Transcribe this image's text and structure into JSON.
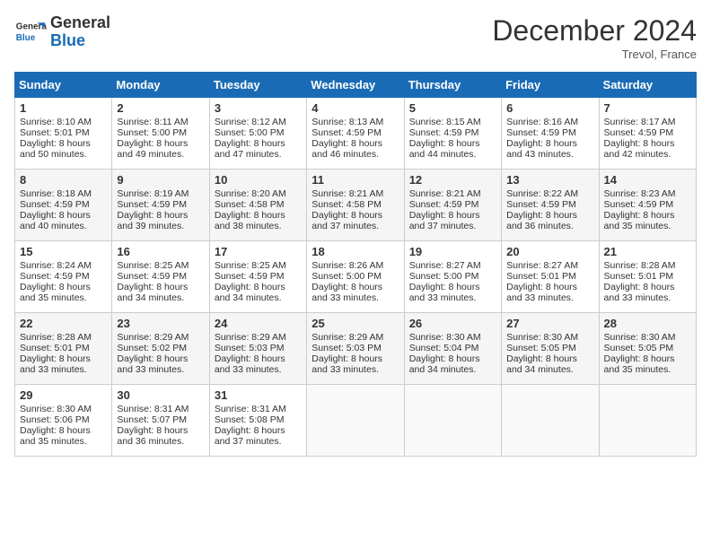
{
  "header": {
    "logo_line1": "General",
    "logo_line2": "Blue",
    "month": "December 2024",
    "location": "Trevol, France"
  },
  "days_of_week": [
    "Sunday",
    "Monday",
    "Tuesday",
    "Wednesday",
    "Thursday",
    "Friday",
    "Saturday"
  ],
  "weeks": [
    [
      {
        "day": "1",
        "sunrise": "8:10 AM",
        "sunset": "5:01 PM",
        "daylight": "8 hours and 50 minutes."
      },
      {
        "day": "2",
        "sunrise": "8:11 AM",
        "sunset": "5:00 PM",
        "daylight": "8 hours and 49 minutes."
      },
      {
        "day": "3",
        "sunrise": "8:12 AM",
        "sunset": "5:00 PM",
        "daylight": "8 hours and 47 minutes."
      },
      {
        "day": "4",
        "sunrise": "8:13 AM",
        "sunset": "4:59 PM",
        "daylight": "8 hours and 46 minutes."
      },
      {
        "day": "5",
        "sunrise": "8:15 AM",
        "sunset": "4:59 PM",
        "daylight": "8 hours and 44 minutes."
      },
      {
        "day": "6",
        "sunrise": "8:16 AM",
        "sunset": "4:59 PM",
        "daylight": "8 hours and 43 minutes."
      },
      {
        "day": "7",
        "sunrise": "8:17 AM",
        "sunset": "4:59 PM",
        "daylight": "8 hours and 42 minutes."
      }
    ],
    [
      {
        "day": "8",
        "sunrise": "8:18 AM",
        "sunset": "4:59 PM",
        "daylight": "8 hours and 40 minutes."
      },
      {
        "day": "9",
        "sunrise": "8:19 AM",
        "sunset": "4:59 PM",
        "daylight": "8 hours and 39 minutes."
      },
      {
        "day": "10",
        "sunrise": "8:20 AM",
        "sunset": "4:58 PM",
        "daylight": "8 hours and 38 minutes."
      },
      {
        "day": "11",
        "sunrise": "8:21 AM",
        "sunset": "4:58 PM",
        "daylight": "8 hours and 37 minutes."
      },
      {
        "day": "12",
        "sunrise": "8:21 AM",
        "sunset": "4:59 PM",
        "daylight": "8 hours and 37 minutes."
      },
      {
        "day": "13",
        "sunrise": "8:22 AM",
        "sunset": "4:59 PM",
        "daylight": "8 hours and 36 minutes."
      },
      {
        "day": "14",
        "sunrise": "8:23 AM",
        "sunset": "4:59 PM",
        "daylight": "8 hours and 35 minutes."
      }
    ],
    [
      {
        "day": "15",
        "sunrise": "8:24 AM",
        "sunset": "4:59 PM",
        "daylight": "8 hours and 35 minutes."
      },
      {
        "day": "16",
        "sunrise": "8:25 AM",
        "sunset": "4:59 PM",
        "daylight": "8 hours and 34 minutes."
      },
      {
        "day": "17",
        "sunrise": "8:25 AM",
        "sunset": "4:59 PM",
        "daylight": "8 hours and 34 minutes."
      },
      {
        "day": "18",
        "sunrise": "8:26 AM",
        "sunset": "5:00 PM",
        "daylight": "8 hours and 33 minutes."
      },
      {
        "day": "19",
        "sunrise": "8:27 AM",
        "sunset": "5:00 PM",
        "daylight": "8 hours and 33 minutes."
      },
      {
        "day": "20",
        "sunrise": "8:27 AM",
        "sunset": "5:01 PM",
        "daylight": "8 hours and 33 minutes."
      },
      {
        "day": "21",
        "sunrise": "8:28 AM",
        "sunset": "5:01 PM",
        "daylight": "8 hours and 33 minutes."
      }
    ],
    [
      {
        "day": "22",
        "sunrise": "8:28 AM",
        "sunset": "5:01 PM",
        "daylight": "8 hours and 33 minutes."
      },
      {
        "day": "23",
        "sunrise": "8:29 AM",
        "sunset": "5:02 PM",
        "daylight": "8 hours and 33 minutes."
      },
      {
        "day": "24",
        "sunrise": "8:29 AM",
        "sunset": "5:03 PM",
        "daylight": "8 hours and 33 minutes."
      },
      {
        "day": "25",
        "sunrise": "8:29 AM",
        "sunset": "5:03 PM",
        "daylight": "8 hours and 33 minutes."
      },
      {
        "day": "26",
        "sunrise": "8:30 AM",
        "sunset": "5:04 PM",
        "daylight": "8 hours and 34 minutes."
      },
      {
        "day": "27",
        "sunrise": "8:30 AM",
        "sunset": "5:05 PM",
        "daylight": "8 hours and 34 minutes."
      },
      {
        "day": "28",
        "sunrise": "8:30 AM",
        "sunset": "5:05 PM",
        "daylight": "8 hours and 35 minutes."
      }
    ],
    [
      {
        "day": "29",
        "sunrise": "8:30 AM",
        "sunset": "5:06 PM",
        "daylight": "8 hours and 35 minutes."
      },
      {
        "day": "30",
        "sunrise": "8:31 AM",
        "sunset": "5:07 PM",
        "daylight": "8 hours and 36 minutes."
      },
      {
        "day": "31",
        "sunrise": "8:31 AM",
        "sunset": "5:08 PM",
        "daylight": "8 hours and 37 minutes."
      },
      null,
      null,
      null,
      null
    ]
  ]
}
